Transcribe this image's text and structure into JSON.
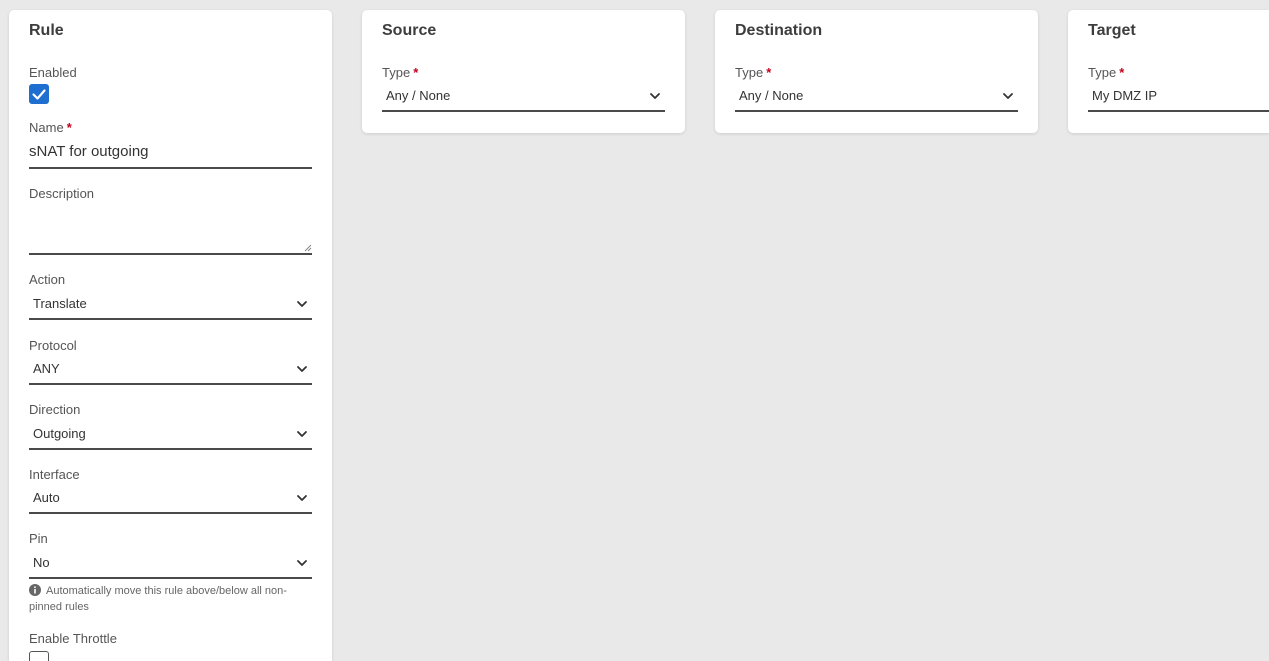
{
  "rule": {
    "title": "Rule",
    "enabled": {
      "label": "Enabled",
      "checked": true
    },
    "name": {
      "label": "Name",
      "value": "sNAT for outgoing",
      "required": "*"
    },
    "description": {
      "label": "Description",
      "value": ""
    },
    "action": {
      "label": "Action",
      "value": "Translate"
    },
    "protocol": {
      "label": "Protocol",
      "value": "ANY"
    },
    "direction": {
      "label": "Direction",
      "value": "Outgoing"
    },
    "interface": {
      "label": "Interface",
      "value": "Auto"
    },
    "pin": {
      "label": "Pin",
      "value": "No",
      "help": "Automatically move this rule above/below all non-pinned rules"
    },
    "enable_throttle": {
      "label": "Enable Throttle",
      "checked": false
    }
  },
  "source": {
    "title": "Source",
    "type": {
      "label": "Type",
      "required": "*",
      "value": "Any / None"
    }
  },
  "destination": {
    "title": "Destination",
    "type": {
      "label": "Type",
      "required": "*",
      "value": "Any / None"
    }
  },
  "target": {
    "title": "Target",
    "type": {
      "label": "Type",
      "required": "*",
      "value": "My DMZ IP"
    }
  },
  "colors": {
    "page_bg": "#e9e9e9",
    "card_bg": "#ffffff",
    "checkbox_checked": "#1f6fd1",
    "required_asterisk": "#c4001a"
  },
  "icons": {
    "select_chevron": "chevron-down-icon",
    "help": "info-icon",
    "checked": "check-icon"
  }
}
